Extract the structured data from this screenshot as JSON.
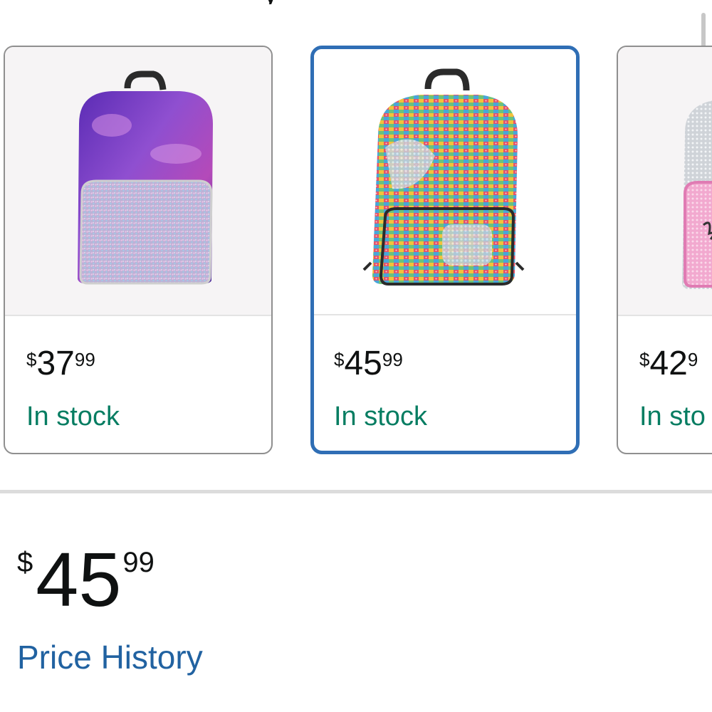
{
  "header": {
    "title_fragment": "y"
  },
  "products": [
    {
      "price": {
        "currency": "$",
        "whole": "37",
        "cents": "99"
      },
      "stock": "In stock",
      "image_icon": "backpack-purple-galaxy-icon",
      "selected": false
    },
    {
      "price": {
        "currency": "$",
        "whole": "45",
        "cents": "99"
      },
      "stock": "In stock",
      "image_icon": "backpack-rainbow-sequin-icon",
      "selected": true
    },
    {
      "price": {
        "currency": "$",
        "whole": "42",
        "cents": "9"
      },
      "stock": "In sto",
      "image_icon": "backpack-silver-pink-icon",
      "selected": false
    }
  ],
  "selected_price": {
    "currency": "$",
    "whole": "45",
    "cents": "99"
  },
  "links": {
    "price_history": "Price History"
  },
  "colors": {
    "accent": "#2f6eb5",
    "link": "#2162a1",
    "in_stock": "#067d62",
    "card_border": "#8f8f8f"
  }
}
